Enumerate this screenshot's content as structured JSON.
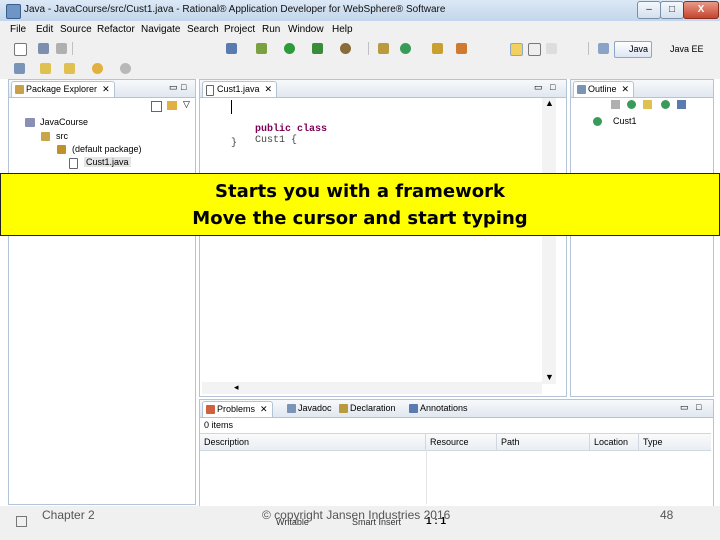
{
  "window": {
    "title": "Java - JavaCourse/src/Cust1.java - Rational® Application Developer for WebSphere® Software",
    "minimize_label": "–",
    "maximize_label": "□",
    "close_label": "X"
  },
  "menu": [
    "File",
    "Edit",
    "Source",
    "Refactor",
    "Navigate",
    "Search",
    "Project",
    "Run",
    "Window",
    "Help"
  ],
  "perspectives": [
    "Java",
    "Java EE"
  ],
  "package_explorer": {
    "tab_label": "Package Explorer",
    "tree": {
      "project": "JavaCourse",
      "folder": "src",
      "package": "(default package)",
      "file": "Cust1.java"
    }
  },
  "editor": {
    "tab_label": "Cust1.java",
    "code_line1_keywords": "public class",
    "code_line1_name": "Cust1 {",
    "code_line2": "}"
  },
  "outline": {
    "tab_label": "Outline",
    "item": "Cust1"
  },
  "overlay": {
    "line1": "Starts you with a framework",
    "line2": "Move the cursor and start typing"
  },
  "problems": {
    "tabs": [
      "Problems",
      "Javadoc",
      "Declaration",
      "Annotations"
    ],
    "count": "0 items",
    "columns": [
      "Description",
      "Resource",
      "Path",
      "Location",
      "Type"
    ]
  },
  "statusbar": {
    "writable": "Writable",
    "insert_mode": "Smart Insert",
    "position": "1 : 1"
  },
  "slide": {
    "chapter": "Chapter 2",
    "copyright": "© copyright Jansen Industries 2016",
    "page_number": "48"
  },
  "colors": {
    "overlay": "#ffff00",
    "keyword": "#7f0055",
    "selection_blue": "#3465a4"
  }
}
